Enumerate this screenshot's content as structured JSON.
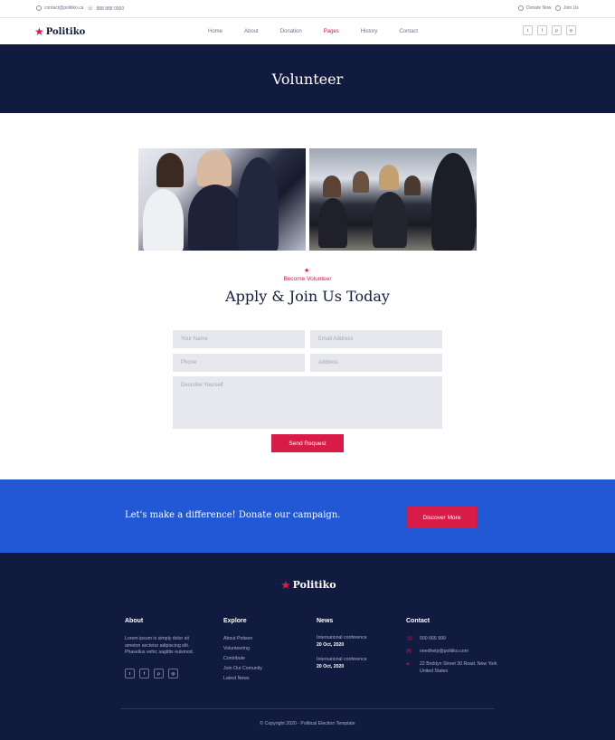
{
  "topbar": {
    "email": "contact@politiko.ca",
    "phone": "888 888 0000",
    "donate": "Donate Now",
    "join": "Join Us"
  },
  "brand": {
    "name": "Politiko",
    "accent": "#d81c47",
    "navy": "#111b3f",
    "blue": "#2258d3"
  },
  "nav": [
    {
      "label": "Home"
    },
    {
      "label": "About"
    },
    {
      "label": "Donation"
    },
    {
      "label": "Pages",
      "active": true
    },
    {
      "label": "History"
    },
    {
      "label": "Contact"
    }
  ],
  "social": [
    "twitter-icon",
    "facebook-icon",
    "pinterest-icon",
    "instagram-icon"
  ],
  "banner": {
    "title": "Volunteer"
  },
  "section": {
    "eyebrow": "Become Volunteer",
    "title": "Apply & Join Us Today"
  },
  "form": {
    "name_placeholder": "Your Name",
    "email_placeholder": "Email Address",
    "phone_placeholder": "Phone",
    "address_placeholder": "Address",
    "message_placeholder": "Describe Yourself",
    "submit_label": "Send Request"
  },
  "cta": {
    "text": "Let's make a difference! Donate our campaign.",
    "button_label": "Discover More"
  },
  "footer": {
    "about": {
      "heading": "About",
      "text": "Lorem ipsum is simply dolor sit ameton sectetur adipiscing elit. Phasellus vehic sagittis euismod."
    },
    "explore": {
      "heading": "Explore",
      "links": [
        "About Potisen",
        "Volunteering",
        "Contribute",
        "Join Our Comunity",
        "Latest News"
      ]
    },
    "news": {
      "heading": "News",
      "items": [
        {
          "title": "International conference",
          "date": "20 Oct, 2020"
        },
        {
          "title": "International conference",
          "date": "20 Oct, 2020"
        }
      ]
    },
    "contact": {
      "heading": "Contact",
      "phone": "000 666 999",
      "email": "needhelp@politiko.com",
      "address": "22 Broklyn Street 30 Road. New York United States"
    },
    "copyright": "© Copyright 2020 - Political Election Template"
  }
}
